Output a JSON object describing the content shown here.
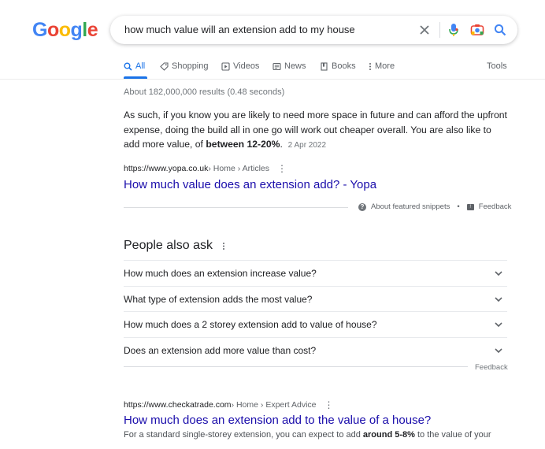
{
  "logo": {
    "text": "Google",
    "colors": [
      "#4285f4",
      "#ea4335",
      "#fbbc05",
      "#4285f4",
      "#34a853",
      "#ea4335"
    ]
  },
  "search": {
    "query": "how much value will an extension add to my house"
  },
  "tabs": [
    {
      "label": "All",
      "icon": "search-icon"
    },
    {
      "label": "Shopping",
      "icon": "tag-icon"
    },
    {
      "label": "Videos",
      "icon": "play-icon"
    },
    {
      "label": "News",
      "icon": "news-icon"
    },
    {
      "label": "Books",
      "icon": "book-icon"
    },
    {
      "label": "More",
      "icon": "kebab-icon"
    }
  ],
  "tools_label": "Tools",
  "stats": "About 182,000,000 results (0.48 seconds)",
  "featured_snippet": {
    "text_before": "As such, if you know you are likely to need more space in future and can afford the upfront expense, doing the build all in one go will work out cheaper overall. You are also like to add more value, of ",
    "bold": "between 12-20%",
    "text_after": ".",
    "date": "2 Apr 2022",
    "site": "https://www.yopa.co.uk",
    "breadcrumb": " › Home › Articles",
    "title": "How much value does an extension add? - Yopa",
    "about_label": "About featured snippets",
    "bullet": "•",
    "feedback_label": "Feedback"
  },
  "people_also_ask": {
    "title": "People also ask",
    "questions": [
      "How much does an extension increase value?",
      "What type of extension adds the most value?",
      "How much does a 2 storey extension add to value of house?",
      "Does an extension add more value than cost?"
    ],
    "feedback_label": "Feedback"
  },
  "result2": {
    "site": "https://www.checkatrade.com",
    "breadcrumb": " › Home › Expert Advice",
    "title": "How much does an extension add to the value of a house?",
    "desc_before": "For a standard single-storey extension, you can expect to add ",
    "desc_bold": "around 5-8%",
    "desc_after": " to the value of your"
  },
  "colors": {
    "link": "#1a0dab",
    "accent": "#1a73e8",
    "text": "#202124",
    "muted": "#70757a"
  }
}
